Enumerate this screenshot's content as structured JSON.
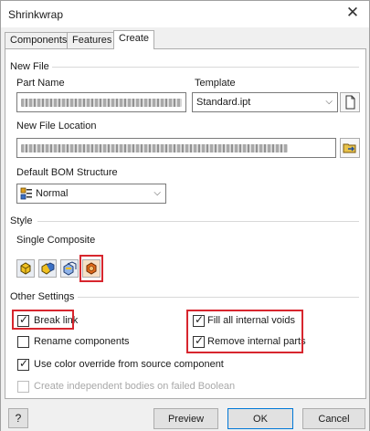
{
  "window": {
    "title": "Shrinkwrap",
    "close_symbol": "✕"
  },
  "tabs": [
    {
      "label": "Components",
      "active": false
    },
    {
      "label": "Features",
      "active": false
    },
    {
      "label": "Create",
      "active": true
    }
  ],
  "new_file": {
    "section_label": "New File",
    "part_name_label": "Part Name",
    "part_name_value": "",
    "template_label": "Template",
    "template_value": "Standard.ipt",
    "location_label": "New File Location",
    "location_value": "",
    "bom_label": "Default BOM Structure",
    "bom_value": "Normal"
  },
  "style": {
    "section_label": "Style",
    "current_style": "Single Composite",
    "buttons": [
      {
        "icon": "single-composite-icon",
        "selected": false
      },
      {
        "icon": "multi-composite-icon",
        "selected": false
      },
      {
        "icon": "surface-composite-icon",
        "selected": false
      },
      {
        "icon": "solid-body-icon",
        "selected": true
      }
    ]
  },
  "other_settings": {
    "section_label": "Other Settings",
    "break_link": {
      "label": "Break link",
      "checked": true
    },
    "rename_components": {
      "label": "Rename components",
      "checked": false
    },
    "use_color_override": {
      "label": "Use color override from source component",
      "checked": true
    },
    "create_independent_bodies": {
      "label": "Create independent bodies on failed Boolean",
      "checked": false,
      "disabled": true
    },
    "fill_internal_voids": {
      "label": "Fill all internal voids",
      "checked": true
    },
    "remove_internal_parts": {
      "label": "Remove internal parts",
      "checked": true
    }
  },
  "footer": {
    "help_symbol": "?",
    "preview_label": "Preview",
    "ok_label": "OK",
    "cancel_label": "Cancel"
  },
  "colors": {
    "highlight": "#d7262e",
    "accent": "#0078d7"
  }
}
